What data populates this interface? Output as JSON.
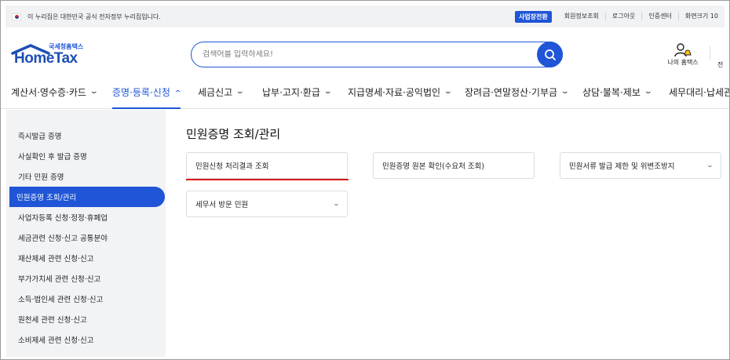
{
  "gov_banner": {
    "text": "이 누리집은 대한민국 공식 전자정부 누리집입니다.",
    "links": [
      "사업장전환",
      "회원정보조회",
      "로그아웃",
      "인증센터",
      "화면크기 10"
    ]
  },
  "logo": {
    "sub": "국세청홈택스",
    "main": "HomeTax"
  },
  "search": {
    "placeholder": "검색어를 입력하세요!"
  },
  "header": {
    "my_home": "나의 홈택스",
    "edge_text": "전"
  },
  "gnb": {
    "items": [
      {
        "label": "계산서·영수증·카드"
      },
      {
        "label": "증명·등록·신청"
      },
      {
        "label": "세금신고"
      },
      {
        "label": "납부·고지·환급"
      },
      {
        "label": "지급명세·자료·공익법인"
      },
      {
        "label": "장려금·연말정산·기부금"
      },
      {
        "label": "상담·불복·제보"
      },
      {
        "label": "세무대리·납세관"
      }
    ],
    "active_index": 1
  },
  "sidebar": {
    "items": [
      {
        "label": "즉시발급 증명"
      },
      {
        "label": "사실확인 후 발급 증명"
      },
      {
        "label": "기타 민원 증명"
      },
      {
        "label": "민원증명 조회/관리"
      },
      {
        "label": "사업자등록 신청·정정·휴폐업"
      },
      {
        "label": "세금관련 신청·신고 공통분야"
      },
      {
        "label": "재산제세 관련 신청·신고"
      },
      {
        "label": "부가가치세 관련 신청·신고"
      },
      {
        "label": "소득·법인세 관련 신청·신고"
      },
      {
        "label": "원천세 관련 신청·신고"
      },
      {
        "label": "소비제세 관련 신청·신고"
      }
    ],
    "active_index": 3
  },
  "content": {
    "title": "민원증명 조회/관리",
    "cards": [
      {
        "label": "민원신청 처리결과 조회"
      },
      {
        "label": "민원증명 원본 확인(수요처 조회)"
      },
      {
        "label": "민원서류 발급 제한 및 위변조방지"
      },
      {
        "label": "세무서 방문 민원"
      }
    ]
  },
  "colors": {
    "accent": "#1f55d6",
    "highlight_underline": "#d81b1b"
  }
}
